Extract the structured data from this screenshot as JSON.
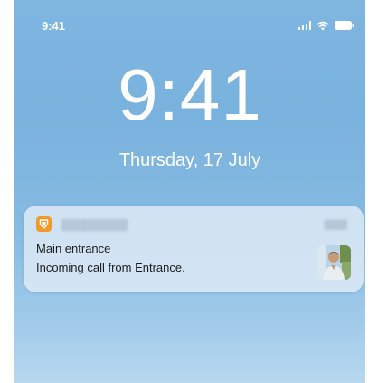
{
  "status_bar": {
    "time": "9:41"
  },
  "lock_screen": {
    "clock": "9:41",
    "date": "Thursday, 17 July"
  },
  "notification": {
    "title": "Main entrance",
    "body": "Incoming call from Entrance.",
    "app_icon": "door-app-icon",
    "thumbnail": "caller-photo-thumbnail"
  },
  "colors": {
    "app_icon_bg": "#f19a2b",
    "wallpaper_top": "#7fb6e0",
    "wallpaper_bottom": "#b7d8ef"
  }
}
